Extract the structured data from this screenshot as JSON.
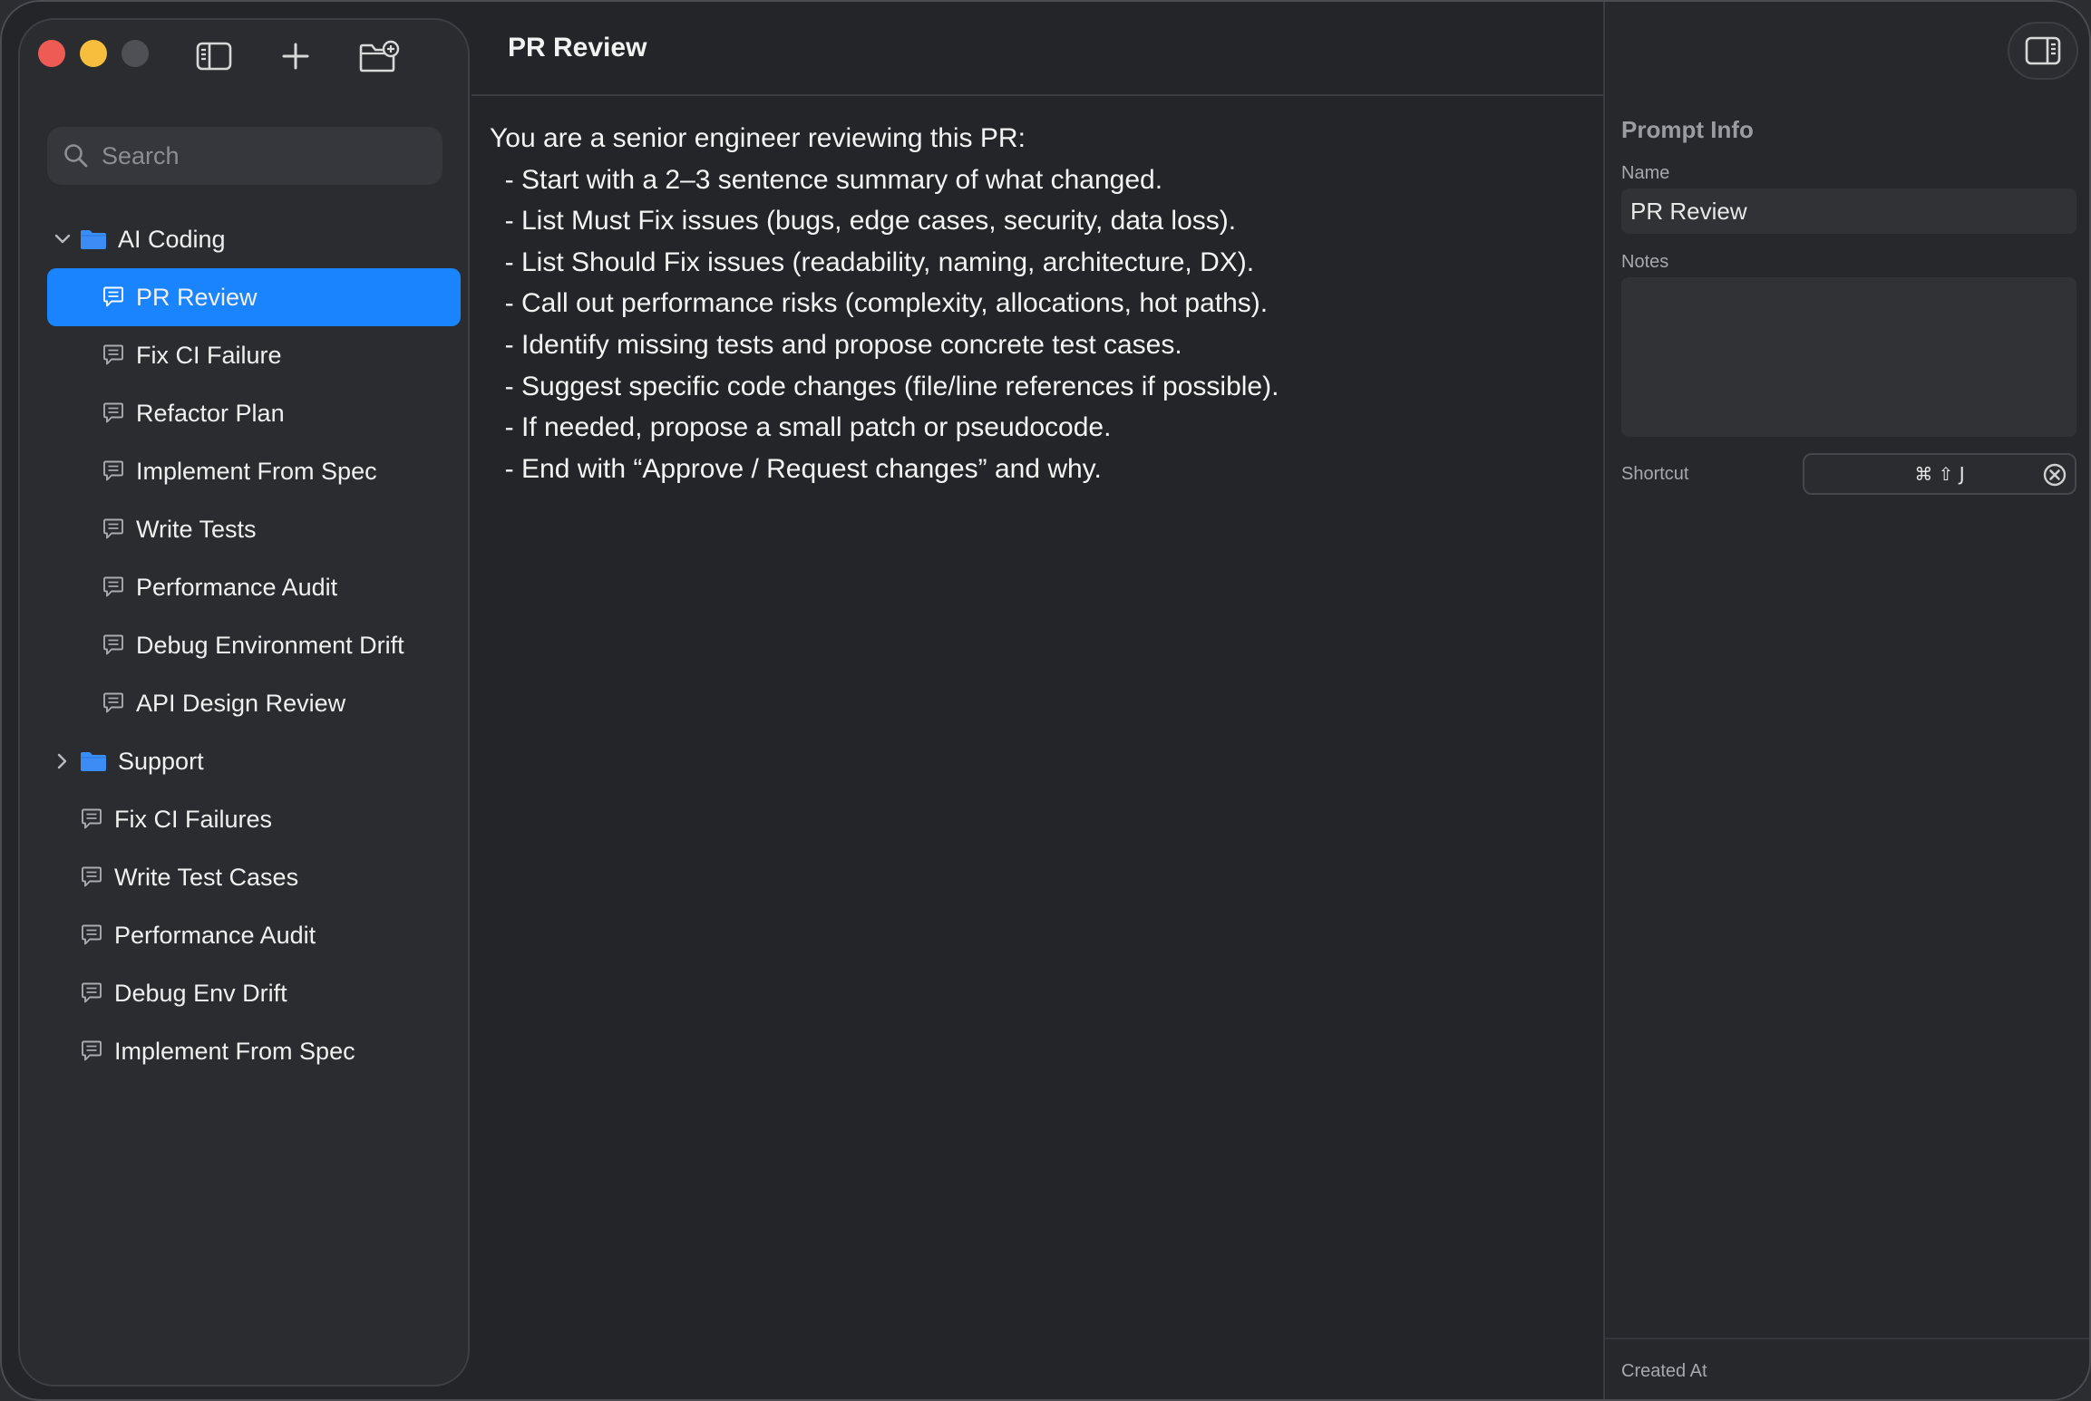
{
  "sidebar": {
    "search_placeholder": "Search",
    "tree": [
      {
        "type": "folder",
        "label": "AI Coding",
        "expanded": true,
        "level": 0
      },
      {
        "type": "prompt",
        "label": "PR Review",
        "selected": true,
        "level": 1
      },
      {
        "type": "prompt",
        "label": "Fix CI Failure",
        "level": 1
      },
      {
        "type": "prompt",
        "label": "Refactor Plan",
        "level": 1
      },
      {
        "type": "prompt",
        "label": "Implement From Spec",
        "level": 1
      },
      {
        "type": "prompt",
        "label": "Write Tests",
        "level": 1
      },
      {
        "type": "prompt",
        "label": "Performance Audit",
        "level": 1
      },
      {
        "type": "prompt",
        "label": "Debug Environment Drift",
        "level": 1
      },
      {
        "type": "prompt",
        "label": "API Design Review",
        "level": 1
      },
      {
        "type": "folder",
        "label": "Support",
        "expanded": false,
        "level": 0
      },
      {
        "type": "prompt",
        "label": "Fix CI Failures",
        "level": 0
      },
      {
        "type": "prompt",
        "label": "Write Test Cases",
        "level": 0
      },
      {
        "type": "prompt",
        "label": "Performance Audit",
        "level": 0
      },
      {
        "type": "prompt",
        "label": "Debug Env Drift",
        "level": 0
      },
      {
        "type": "prompt",
        "label": "Implement From Spec",
        "level": 0
      }
    ]
  },
  "main": {
    "title": "PR Review",
    "content_lines": [
      "You are a senior engineer reviewing this PR:",
      "  - Start with a 2–3 sentence summary of what changed.",
      "  - List Must Fix issues (bugs, edge cases, security, data loss).",
      "  - List Should Fix issues (readability, naming, architecture, DX).",
      "  - Call out performance risks (complexity, allocations, hot paths).",
      "  - Identify missing tests and propose concrete test cases.",
      "  - Suggest specific code changes (file/line references if possible).",
      "  - If needed, propose a small patch or pseudocode.",
      "  - End with “Approve / Request changes” and why."
    ]
  },
  "inspector": {
    "heading": "Prompt Info",
    "name_label": "Name",
    "name_value": "PR Review",
    "notes_label": "Notes",
    "notes_value": "",
    "shortcut_label": "Shortcut",
    "shortcut_value": "⌘ ⇧ J",
    "created_label": "Created At"
  },
  "colors": {
    "accent": "#1a84ff",
    "folder": "#3b8cf5",
    "close": "#ee5b54",
    "minimize": "#f6be3c"
  },
  "icons": {
    "toolbar": [
      "sidebar-toggle-icon",
      "plus-icon",
      "new-folder-icon"
    ],
    "inspector_toggle": "inspector-toggle-icon"
  }
}
